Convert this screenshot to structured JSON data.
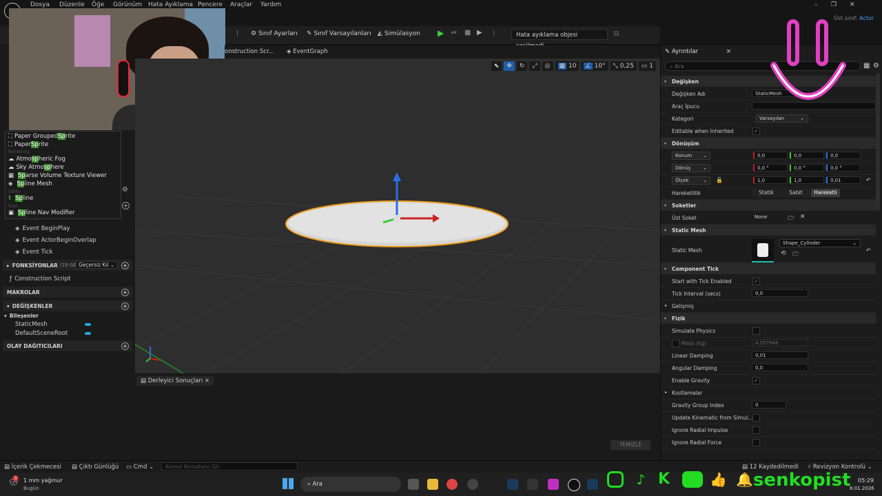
{
  "menu": [
    "Dosya",
    "Düzenle",
    "Öğe",
    "Görünüm",
    "Hata Ayıklama",
    "Pencere",
    "Araçlar",
    "Yardım"
  ],
  "parent_class": {
    "label": "Üst sınıf:",
    "value": "Actor"
  },
  "toolbar": {
    "class_settings": "Sınıf Ayarları",
    "class_defaults": "Sınıf Varsayılanları",
    "simulation": "Simülasyon",
    "debug_object": "Hata ayıklama objesi seçilmedi"
  },
  "tabs": {
    "construction": "onstruction Scr...",
    "event_graph": "EventGraph"
  },
  "viewport": {
    "grid_snap": "10",
    "rot_snap": "10°",
    "scale_snap": "0,25",
    "camera_speed": "1"
  },
  "dropdown": {
    "items": [
      {
        "pre": "Paper Grouped ",
        "hl": "Sp",
        "post": "rite"
      },
      {
        "pre": "Paper ",
        "hl": "Sp",
        "post": "rite"
      },
      {
        "cat": "Rendering"
      },
      {
        "pre": "Atmo",
        "hl": "sp",
        "post": "heric Fog"
      },
      {
        "pre": "Sky Atmo",
        "hl": "sp",
        "post": "here"
      },
      {
        "pre": "",
        "hl": "Sp",
        "post": "arse Volume Texture Viewer"
      },
      {
        "pre": "",
        "hl": "Sp",
        "post": "line Mesh"
      },
      {
        "cat": "Utility"
      },
      {
        "pre": "",
        "hl": "Sp",
        "post": "line"
      },
      {
        "cat": "Özel"
      },
      {
        "pre": "",
        "hl": "Sp",
        "post": "line Nav Modifier"
      }
    ]
  },
  "left": {
    "event_graph": "EventGraph",
    "events": [
      "Event BeginPlay",
      "Event ActorBeginOverlap",
      "Event Tick"
    ],
    "functions_label": "FONKSİYONLAR",
    "functions_count": "(19 GEÇERSİ",
    "override_label": "Geçersiz Kıl",
    "construction_script": "Construction Script",
    "macros": "MAKROLAR",
    "variables": "DEĞİŞKENLER",
    "components_label": "Bileşenler",
    "components": [
      "StaticMesh",
      "DefaultSceneRoot"
    ],
    "dispatchers": "OLAY DAĞITICILARI"
  },
  "bottom": {
    "tab": "Derleyici Sonuçları",
    "clear": "TEMİZLE"
  },
  "details": {
    "tab": "Ayrıntılar",
    "search_placeholder": "Ara",
    "sec_variable": "Değişken",
    "var_name_label": "Değişken Adı",
    "var_name": "StaticMesh",
    "tooltip_label": "Araç İpucu",
    "category_label": "Kategori",
    "category": "Varsayılan",
    "editable_label": "Editable when Inherited",
    "sec_transform": "Dönüşüm",
    "location_label": "Konum",
    "location": [
      "0,0",
      "0,0",
      "0,0"
    ],
    "rotation_label": "Dönüş",
    "rotation": [
      "0,0 °",
      "0,0 °",
      "0,0 °"
    ],
    "scale_label": "Ölçek",
    "scale": [
      "1,0",
      "1,0",
      "0,01"
    ],
    "mobility_label": "Hareketlilik",
    "mobility": [
      "Statik",
      "Sabit",
      "Hareketli"
    ],
    "sec_sockets": "Soketler",
    "parent_socket_label": "Üst Soket",
    "parent_socket": "None",
    "sec_static_mesh": "Static Mesh",
    "static_mesh_label": "Static Mesh",
    "static_mesh": "Shape_Cylinder",
    "sec_tick": "Component Tick",
    "start_tick_label": "Start with Tick Enabled",
    "tick_interval_label": "Tick Interval (secs)",
    "tick_interval": "0,0",
    "advanced": "Gelişmiş",
    "sec_physics": "Fizik",
    "sim_physics_label": "Simulate Physics",
    "mass_label": "Mass (kg)",
    "mass": "4,557948",
    "linear_damping_label": "Linear Damping",
    "linear_damping": "0,01",
    "angular_damping_label": "Angular Damping",
    "angular_damping": "0,0",
    "gravity_label": "Enable Gravity",
    "constraints": "Kısıtlamalar",
    "gravity_group_label": "Gravity Group Index",
    "gravity_group": "0",
    "update_kinematic_label": "Update Kinematic from Simul...",
    "ignore_impulse_label": "Ignore Radial Impulse",
    "ignore_force_label": "Ignore Radial Force"
  },
  "status": {
    "content_drawer": "İçerik Çekmecesi",
    "output_log": "Çıktı Günlüğü",
    "cmd": "Cmd",
    "console_placeholder": "Konsol Komutunu Gir",
    "saved": "12 Kaydedilmedi",
    "revision": "Revizyon Kontrolü"
  },
  "taskbar": {
    "weather": "1 mm yağmur",
    "weather_sub": "Bugün",
    "badge": "3",
    "search": "Ara",
    "time": "05:29",
    "date": "8.01.2026"
  },
  "brand": "senkopist",
  "colors": {
    "accent": "#1e5ea8",
    "highlight": "#3a8c2c",
    "brand_green": "#22dd22",
    "smile": "#e040c0"
  }
}
